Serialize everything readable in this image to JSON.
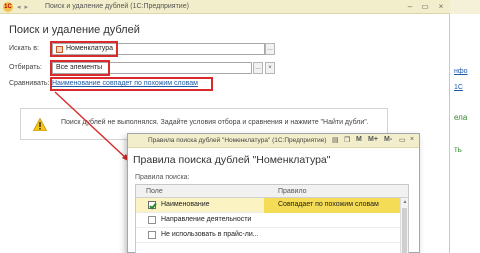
{
  "background": {
    "links": [
      "нфо",
      "1С"
    ],
    "texts": [
      "ела",
      "ть"
    ]
  },
  "main_window": {
    "title": "Поиск и удаление дублей",
    "app_name": "(1С:Предприятие)",
    "form_title": "Поиск и удаление дублей",
    "search_in": {
      "label": "Искать в:",
      "value": "Номенклатура"
    },
    "filter": {
      "label": "Отбирать:",
      "value": "Все элементы"
    },
    "compare": {
      "label": "Сравнивать:",
      "value": "Наименование совпадет по похожим словам"
    },
    "message": "Поиск дублей не выполнялся.  Задайте условия отбора и сравнения и нажмите \"Найти дубли\"."
  },
  "popup": {
    "title": "Правила поиска дублей \"Номенклатура\"",
    "app_name": "(1С:Предприятие)",
    "toolbar": {
      "m": "M",
      "m_plus": "M+",
      "m_minus": "M-"
    },
    "heading": "Правила поиска дублей \"Номенклатура\"",
    "rules_label": "Правила поиска:",
    "columns": {
      "field": "Поле",
      "rule": "Правило"
    },
    "rows": [
      {
        "field": "Наименование",
        "rule": "Совпадает по похожим словам",
        "checked": true
      },
      {
        "field": "Направление деятельности",
        "rule": "",
        "checked": false
      },
      {
        "field": "Не использовать в прайс-ли...",
        "rule": "",
        "checked": false
      }
    ]
  },
  "colors": {
    "highlight": "#d92b2b",
    "link": "#1e5ba8",
    "titlebar": "#f2edca",
    "selected_cell": "#f5dc56"
  },
  "icons": [
    "app-logo-icon",
    "warning-icon",
    "reference-icon",
    "checkbox-checked-icon"
  ]
}
